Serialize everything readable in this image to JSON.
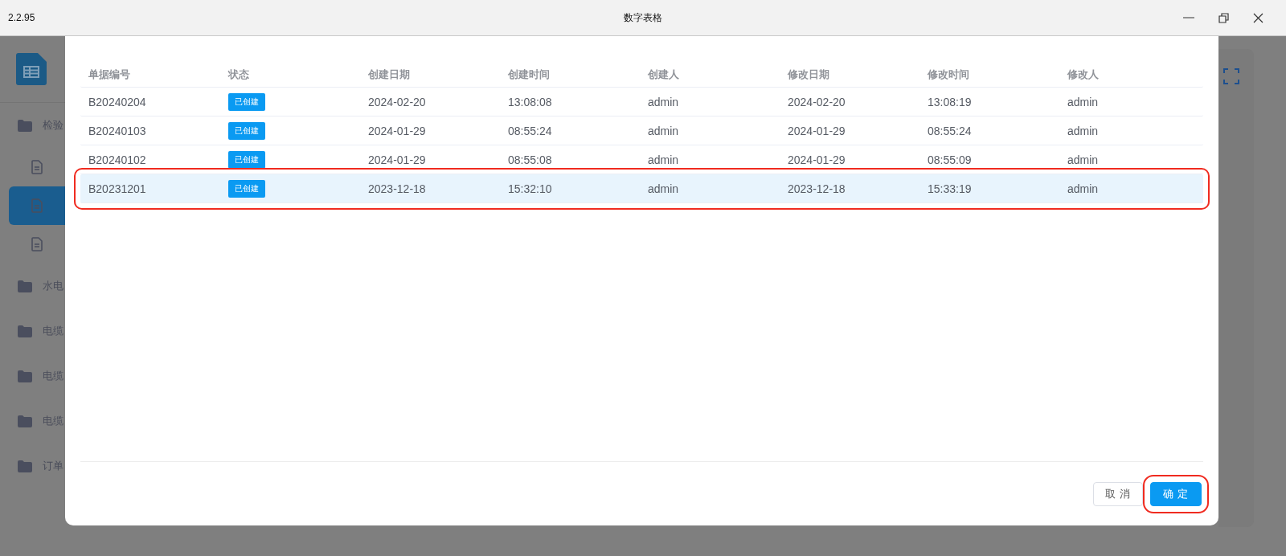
{
  "window": {
    "version": "2.2.95",
    "title": "数字表格"
  },
  "sidebar": {
    "items": [
      {
        "kind": "folder",
        "label": "检验",
        "selected": false
      },
      {
        "kind": "doc",
        "selected": false
      },
      {
        "kind": "doc",
        "selected": true
      },
      {
        "kind": "doc",
        "selected": false
      },
      {
        "kind": "folder",
        "label": "水电",
        "selected": false
      },
      {
        "kind": "folder",
        "label": "电缆",
        "selected": false
      },
      {
        "kind": "folder",
        "label": "电缆",
        "selected": false
      },
      {
        "kind": "folder",
        "label": "电缆",
        "selected": false
      },
      {
        "kind": "folder",
        "label": "订单",
        "selected": false
      }
    ]
  },
  "dialog": {
    "table": {
      "columns": [
        "单据编号",
        "状态",
        "创建日期",
        "创建时间",
        "创建人",
        "修改日期",
        "修改时间",
        "修改人"
      ],
      "rows": [
        {
          "selected": false,
          "annotated": false,
          "cells": [
            "B20240204",
            "已创建",
            "2024-02-20",
            "13:08:08",
            "admin",
            "2024-02-20",
            "13:08:19",
            "admin"
          ]
        },
        {
          "selected": false,
          "annotated": false,
          "cells": [
            "B20240103",
            "已创建",
            "2024-01-29",
            "08:55:24",
            "admin",
            "2024-01-29",
            "08:55:24",
            "admin"
          ]
        },
        {
          "selected": false,
          "annotated": false,
          "cells": [
            "B20240102",
            "已创建",
            "2024-01-29",
            "08:55:08",
            "admin",
            "2024-01-29",
            "08:55:09",
            "admin"
          ]
        },
        {
          "selected": true,
          "annotated": true,
          "cells": [
            "B20231201",
            "已创建",
            "2023-12-18",
            "15:32:10",
            "admin",
            "2023-12-18",
            "15:33:19",
            "admin"
          ]
        }
      ]
    },
    "buttons": [
      {
        "kind": "secondary",
        "label": "取 消",
        "annotated": false
      },
      {
        "kind": "primary",
        "label": "确 定",
        "annotated": true
      }
    ]
  }
}
